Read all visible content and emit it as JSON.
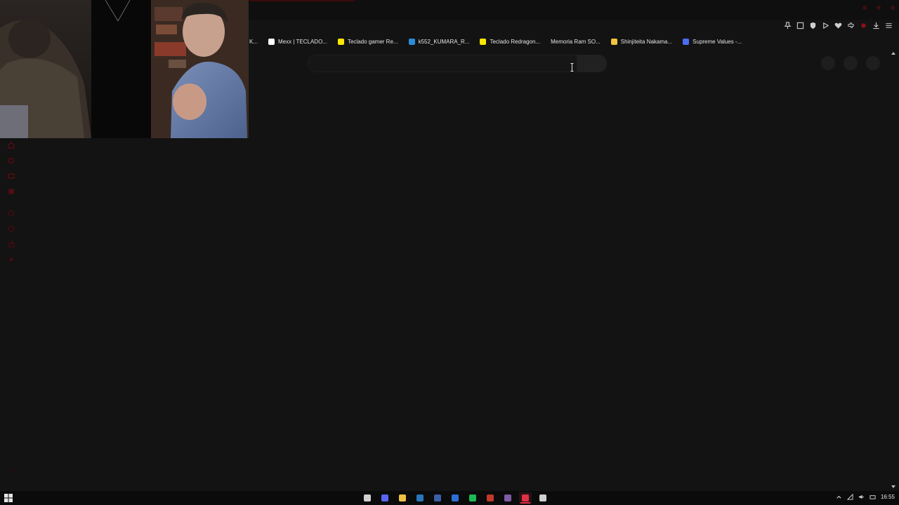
{
  "browser": {
    "bookmarks": [
      {
        "label": "K...",
        "icon": "no-favicon",
        "color": ""
      },
      {
        "label": "Mexx | TECLADO...",
        "icon": "mexx-favicon",
        "color": "#ffffff"
      },
      {
        "label": "Teclado gamer Re...",
        "icon": "mercadolibre-favicon",
        "color": "#ffe600"
      },
      {
        "label": "k552_KUMARA_R...",
        "icon": "drive-favicon",
        "color": "#2a8cd8"
      },
      {
        "label": "Teclado Redragon...",
        "icon": "mercadolibre-favicon",
        "color": "#ffe600"
      },
      {
        "label": "Memoria Ram SO...",
        "icon": "no-favicon",
        "color": ""
      },
      {
        "label": "Shinjiteita Nakama...",
        "icon": "anime-favicon",
        "color": "#f2c53d"
      },
      {
        "label": "Supreme Values -...",
        "icon": "supreme-favicon",
        "color": "#4a6cf0"
      }
    ],
    "search": {
      "placeholder": "",
      "value": ""
    },
    "toolbar_icons": [
      "pin-icon",
      "screenshot-icon",
      "shield-icon",
      "play-icon",
      "heart-icon",
      "extensions-icon",
      "record-icon",
      "download-icon",
      "menu-icon"
    ]
  },
  "taskbar": {
    "apps": [
      {
        "name": "calendar-app-icon",
        "color": "#d0d0d0"
      },
      {
        "name": "discord-app-icon",
        "color": "#5865f2"
      },
      {
        "name": "file-explorer-app-icon",
        "color": "#f0c040"
      },
      {
        "name": "steam-app-icon",
        "color": "#2a75bb"
      },
      {
        "name": "app-icon",
        "color": "#3c5ea8"
      },
      {
        "name": "app-icon-2",
        "color": "#2b6fd6"
      },
      {
        "name": "spotify-app-icon",
        "color": "#1db954"
      },
      {
        "name": "app-icon-3",
        "color": "#c0392b"
      },
      {
        "name": "app-icon-4",
        "color": "#7d5ba6"
      },
      {
        "name": "browser-app-icon",
        "color": "#e03044"
      },
      {
        "name": "obs-app-icon",
        "color": "#cfcfcf"
      }
    ],
    "active_index": 9,
    "clock": "16:55"
  },
  "colors": {
    "accent": "#e03044",
    "background": "#131313"
  }
}
